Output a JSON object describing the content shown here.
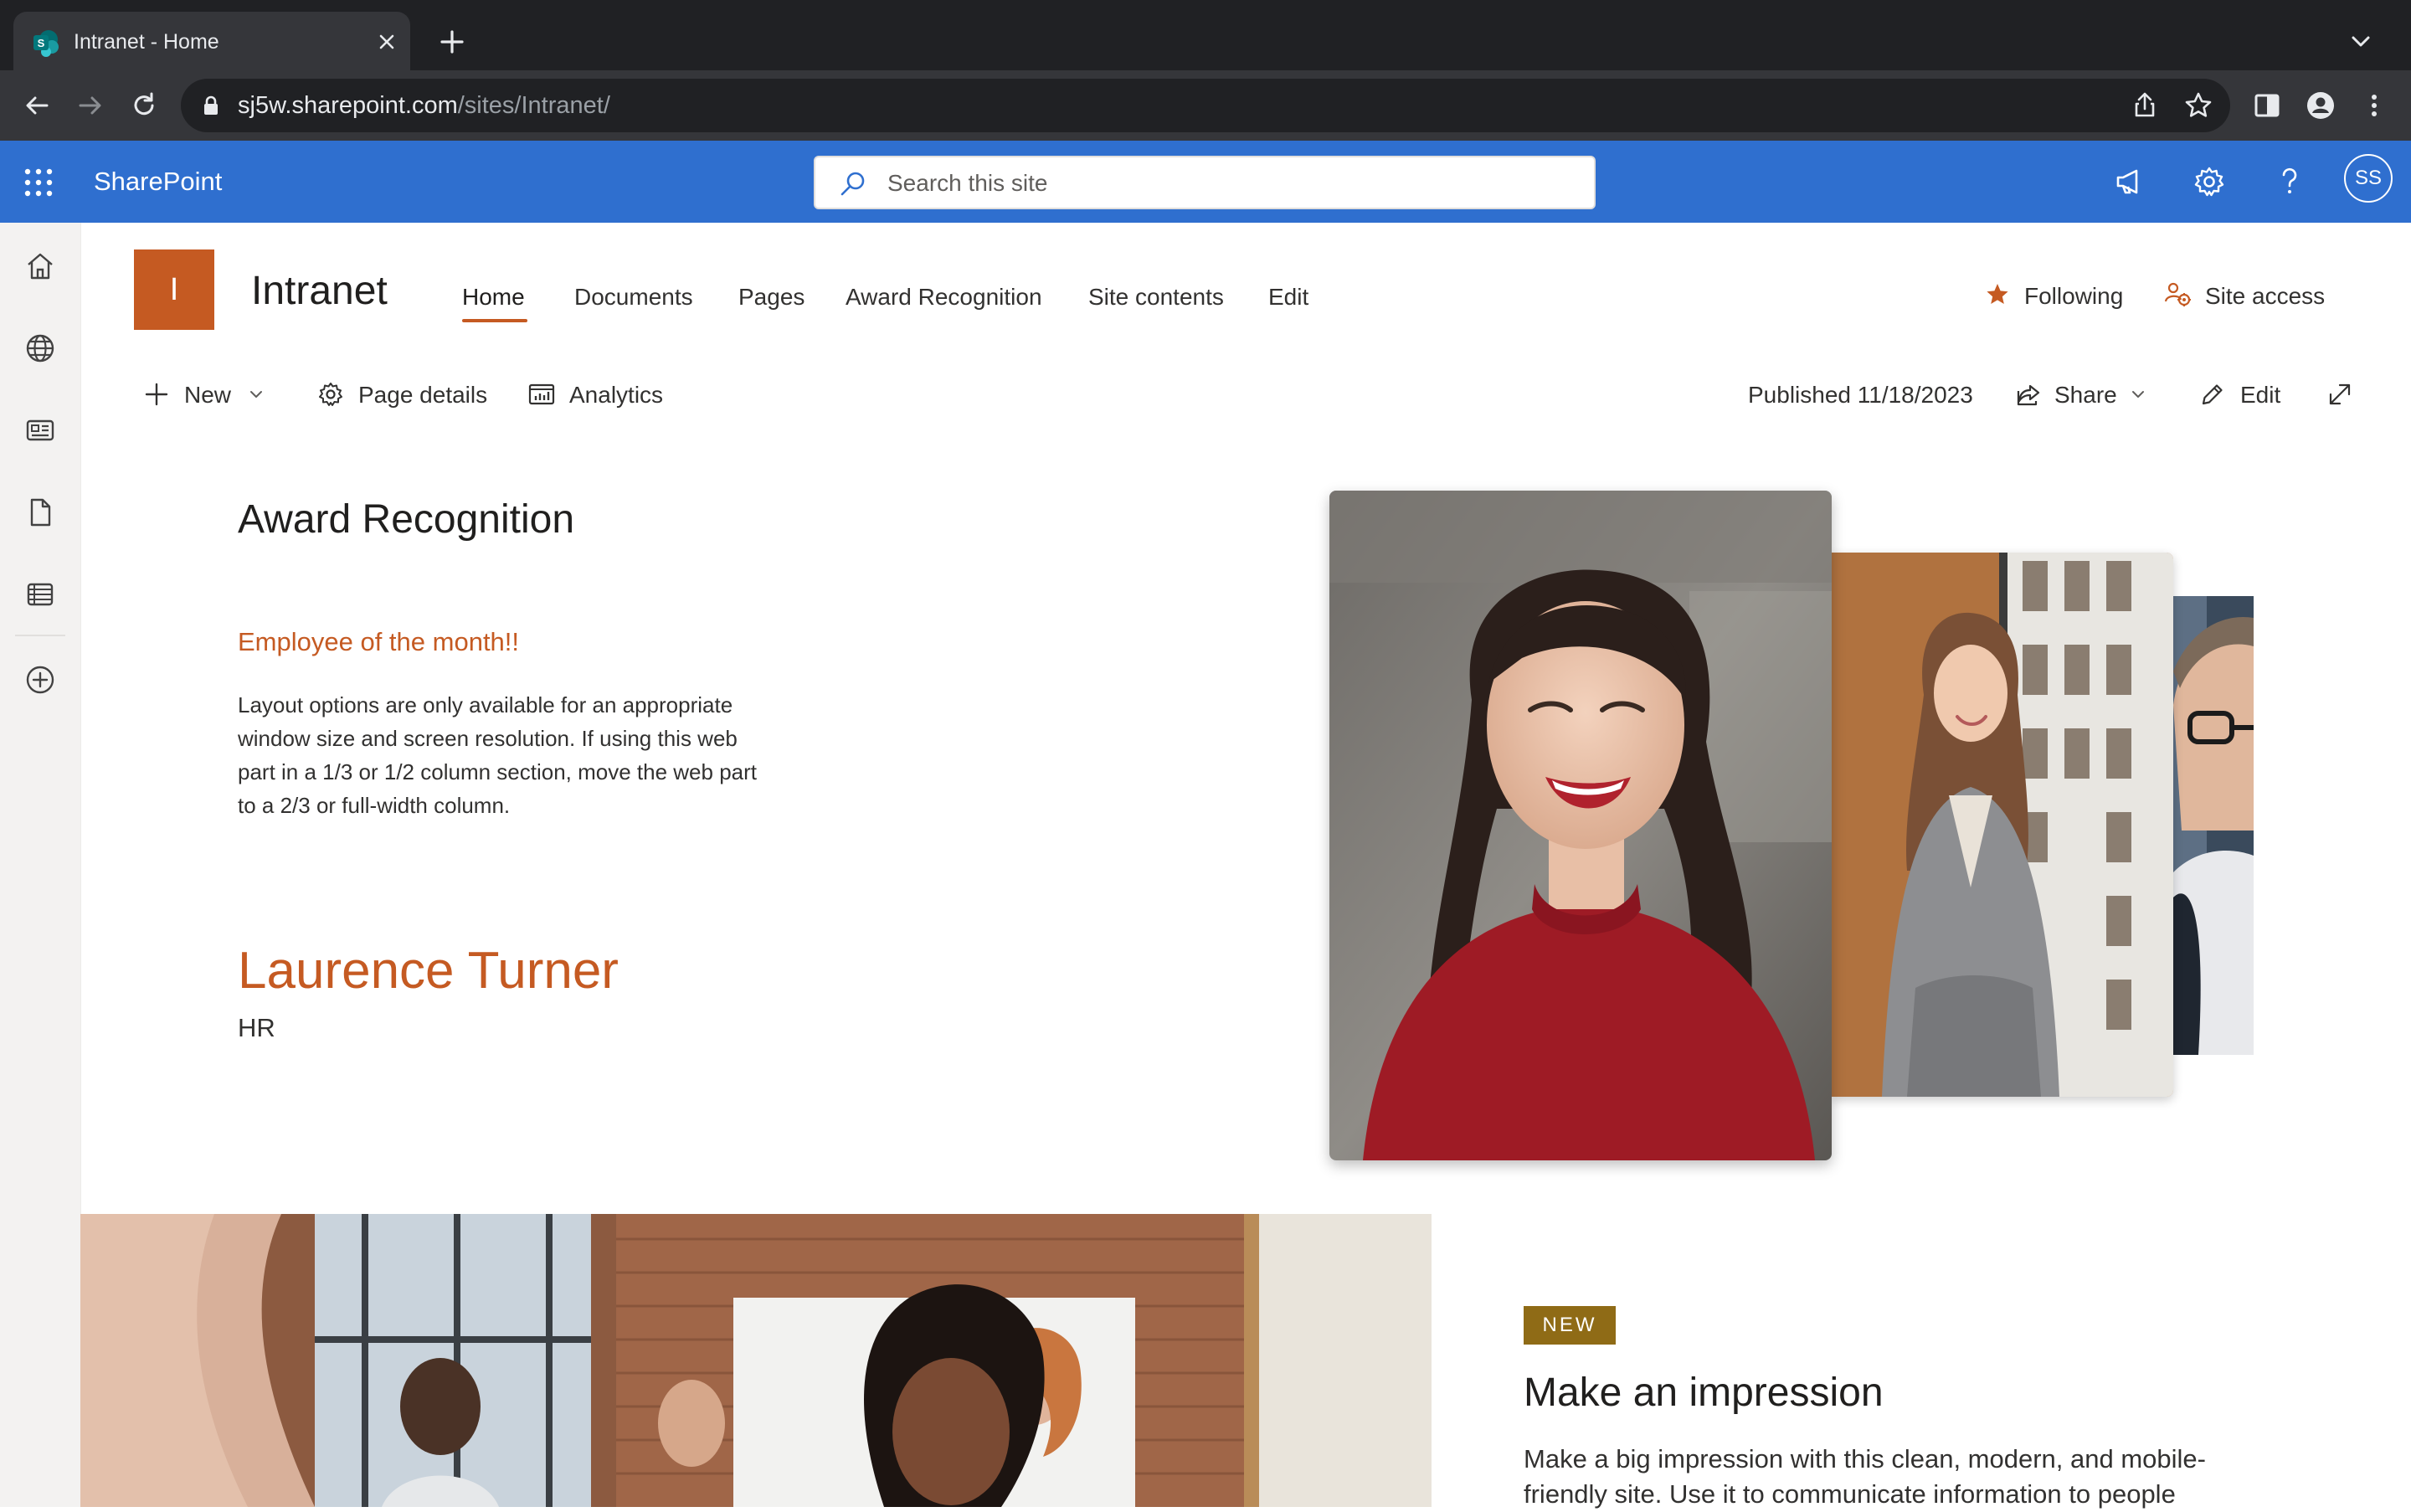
{
  "browser": {
    "tab_title": "Intranet - Home",
    "url_host": "sj5w.sharepoint.com",
    "url_path": "/sites/Intranet/"
  },
  "suite": {
    "brand": "SharePoint",
    "search_placeholder": "Search this site",
    "user_initials": "SS",
    "accent_color": "#2f6fcf"
  },
  "site": {
    "logo_letter": "I",
    "title": "Intranet",
    "logo_color": "#c55a22",
    "nav": [
      "Home",
      "Documents",
      "Pages",
      "Award Recognition",
      "Site contents",
      "Edit"
    ],
    "active_nav": "Home",
    "following_label": "Following",
    "site_access_label": "Site access"
  },
  "command_bar": {
    "new_label": "New",
    "page_details_label": "Page details",
    "analytics_label": "Analytics",
    "published": "Published 11/18/2023",
    "share_label": "Share",
    "edit_label": "Edit"
  },
  "award": {
    "section_title": "Award Recognition",
    "subtitle": "Employee of the month!!",
    "description": "Layout options are only available for an appropriate window size and screen resolution. If using this web part in a 1/3 or 1/2 column section, move the web part to a 2/3 or full-width column.",
    "employee_name": "Laurence Turner",
    "employee_dept": "HR"
  },
  "hero": {
    "badge": "NEW",
    "title": "Make an impression",
    "text": "Make a big impression with this clean, modern, and mobile-friendly site. Use it to communicate information to people"
  }
}
